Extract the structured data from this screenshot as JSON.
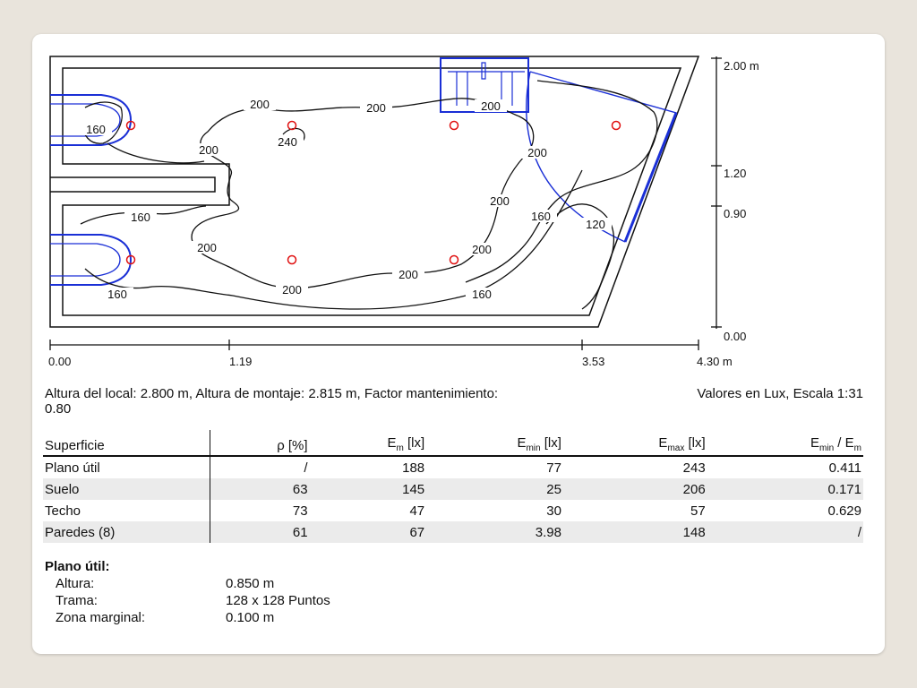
{
  "plan": {
    "x_ticks": [
      "0.00",
      "1.19",
      "3.53",
      "4.30 m"
    ],
    "y_ticks": [
      "2.00 m",
      "1.20",
      "0.90",
      "0.00"
    ],
    "contour_labels": [
      "200",
      "200",
      "200",
      "240",
      "200",
      "160",
      "200",
      "200",
      "160",
      "120",
      "160",
      "200",
      "200",
      "200",
      "200",
      "160",
      "160"
    ]
  },
  "info": {
    "left": "Altura del local: 2.800 m, Altura de montaje: 2.815 m, Factor mantenimiento: 0.80",
    "right": "Valores en Lux, Escala 1:31"
  },
  "table": {
    "headers": {
      "superficie": "Superficie",
      "rho": "ρ [%]",
      "em_main": "E",
      "em_sub": "m",
      "em_unit": " [lx]",
      "emin_main": "E",
      "emin_sub": "min",
      "emin_unit": " [lx]",
      "emax_main": "E",
      "emax_sub": "max",
      "emax_unit": " [lx]",
      "ratio_a": "E",
      "ratio_a_sub": "min",
      "ratio_sep": " / E",
      "ratio_b_sub": "m"
    },
    "rows": [
      {
        "name": "Plano útil",
        "rho": "/",
        "em": "188",
        "emin": "77",
        "emax": "243",
        "ratio": "0.411"
      },
      {
        "name": "Suelo",
        "rho": "63",
        "em": "145",
        "emin": "25",
        "emax": "206",
        "ratio": "0.171"
      },
      {
        "name": "Techo",
        "rho": "73",
        "em": "47",
        "emin": "30",
        "emax": "57",
        "ratio": "0.629"
      },
      {
        "name": "Paredes (8)",
        "rho": "61",
        "em": "67",
        "emin": "3.98",
        "emax": "148",
        "ratio": "/"
      }
    ]
  },
  "plano": {
    "title": "Plano útil:",
    "rows": [
      {
        "k": "Altura:",
        "v": "0.850 m"
      },
      {
        "k": "Trama:",
        "v": "128 x 128 Puntos"
      },
      {
        "k": "Zona marginal:",
        "v": "0.100 m"
      }
    ]
  },
  "colors": {
    "contour": "#111111",
    "fixture": "#1a2fd6",
    "luminaire": "#e01010"
  }
}
